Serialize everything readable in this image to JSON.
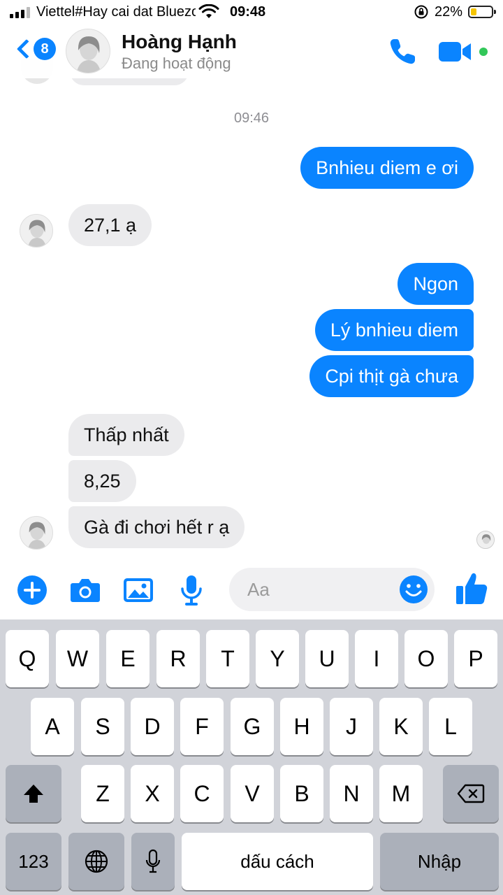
{
  "status_bar": {
    "carrier": "Viettel#Hay cai dat Bluezone",
    "time": "09:48",
    "battery": "22%"
  },
  "header": {
    "back_badge": "8",
    "contact_name": "Hoàng Hạnh",
    "contact_status": "Đang hoạt động"
  },
  "chat": {
    "timestamp": "09:46",
    "messages": [
      {
        "direction": "out",
        "text": "Bnhieu diem e ơi"
      },
      {
        "direction": "in",
        "text": "27,1 ạ"
      },
      {
        "direction": "out",
        "text": "Ngon"
      },
      {
        "direction": "out",
        "text": "Lý bnhieu diem"
      },
      {
        "direction": "out",
        "text": "Cpi thịt gà chưa"
      },
      {
        "direction": "in",
        "text": "Thấp nhất"
      },
      {
        "direction": "in",
        "text": "8,25"
      },
      {
        "direction": "in",
        "text": "Gà đi chơi hết r ạ"
      }
    ]
  },
  "composer": {
    "placeholder": "Aa"
  },
  "keyboard": {
    "row1": [
      "Q",
      "W",
      "E",
      "R",
      "T",
      "Y",
      "U",
      "I",
      "O",
      "P"
    ],
    "row2": [
      "A",
      "S",
      "D",
      "F",
      "G",
      "H",
      "J",
      "K",
      "L"
    ],
    "row3": [
      "Z",
      "X",
      "C",
      "V",
      "B",
      "N",
      "M"
    ],
    "numbers_key": "123",
    "space_key": "dấu cách",
    "return_key": "Nhập"
  },
  "colors": {
    "accent": "#0a84ff",
    "incoming_bubble": "#ebebed",
    "online": "#32c759",
    "keyboard_bg": "#d1d3d9"
  }
}
